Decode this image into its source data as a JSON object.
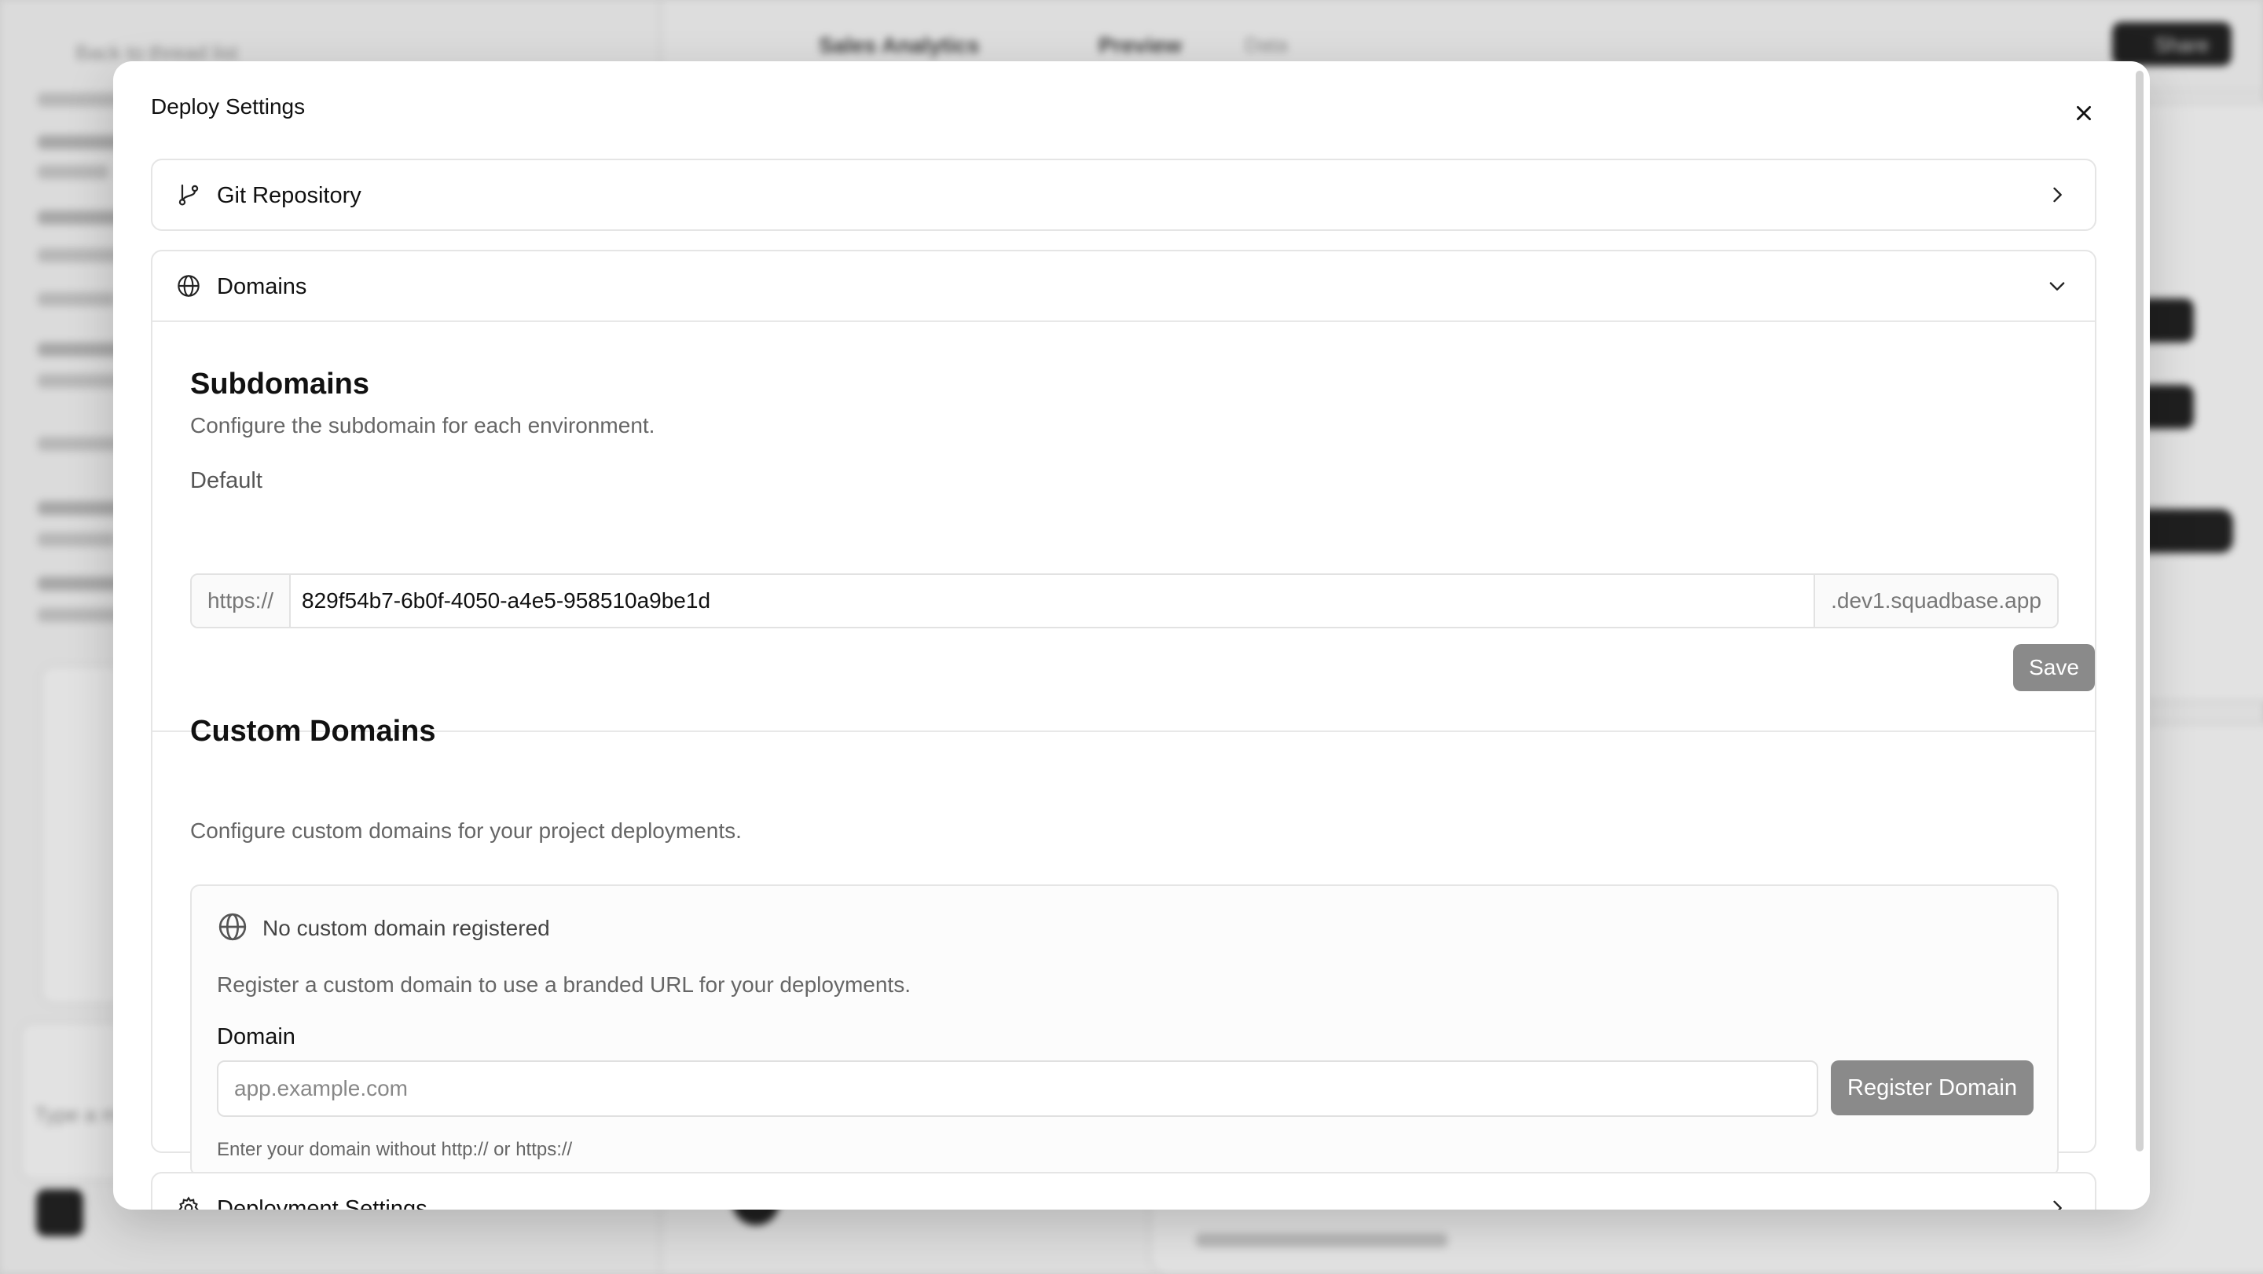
{
  "background": {
    "back_link": "Back to thread list",
    "project_name": "Sales Analytics",
    "preview_tab": "Preview",
    "data_tab": "Data",
    "share_button": "Share",
    "footer_text": "Type a m"
  },
  "modal": {
    "title": "Deploy Settings",
    "close_icon": "close-icon"
  },
  "git_repository": {
    "label": "Git Repository",
    "icon": "git-branch-icon",
    "chevron": "chevron-right-icon"
  },
  "domains": {
    "label": "Domains",
    "icon": "globe-icon",
    "chevron": "chevron-down-icon",
    "subdomains": {
      "title": "Subdomains",
      "description": "Configure the subdomain for each environment.",
      "default_label": "Default",
      "prefix": "https://",
      "value": "829f54b7-6b0f-4050-a4e5-958510a9be1d",
      "suffix": ".dev1.squadbase.app",
      "save_label": "Save"
    },
    "custom_domains": {
      "title": "Custom Domains",
      "description": "Configure custom domains for your project deployments.",
      "empty_title": "No custom domain registered",
      "empty_description": "Register a custom domain to use a branded URL for your deployments.",
      "domain_label": "Domain",
      "domain_placeholder": "app.example.com",
      "domain_value": "",
      "register_label": "Register Domain",
      "hint": "Enter your domain without http:// or https://"
    }
  },
  "deployment_settings": {
    "label": "Deployment Settings",
    "icon": "gear-icon",
    "chevron": "chevron-right-icon"
  },
  "colors": {
    "button_disabled": "#8a8a8a",
    "border": "#e5e5e5",
    "muted_text": "#666666"
  }
}
